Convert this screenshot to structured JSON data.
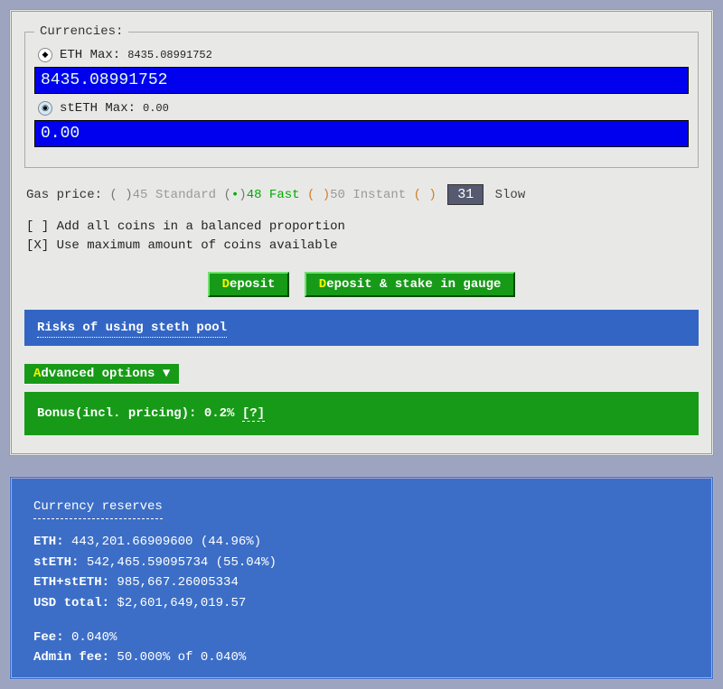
{
  "currencies": {
    "legend": "Currencies:",
    "eth": {
      "label": "ETH Max:",
      "max": "8435.08991752",
      "input": "8435.08991752"
    },
    "steth": {
      "label": "stETH Max:",
      "max": "0.00",
      "input": "0.00"
    }
  },
  "gas": {
    "label": "Gas price:",
    "standard": {
      "val": "45",
      "name": "Standard",
      "sel": false
    },
    "fast": {
      "val": "48",
      "name": "Fast",
      "sel": true
    },
    "instant": {
      "val": "50",
      "name": "Instant",
      "sel": false
    },
    "slow": {
      "val": "31",
      "name": "Slow"
    }
  },
  "opts": {
    "balanced_box": "[ ]",
    "balanced_label": "Add all coins in a balanced proportion",
    "usemax_box": "[X]",
    "usemax_label": "Use maximum amount of coins available"
  },
  "buttons": {
    "deposit_accent": "D",
    "deposit_rest": "eposit",
    "stake_accent": "D",
    "stake_rest": "eposit & stake in gauge"
  },
  "risks": "Risks of using steth pool",
  "advanced": {
    "toggle_accent": "A",
    "toggle_rest": "dvanced options ▼",
    "bonus_label": "Bonus(incl. pricing):",
    "bonus_val": "0.2%",
    "help": "[?]"
  },
  "reserves": {
    "title": "Currency reserves",
    "eth_label": "ETH:",
    "eth_val": "443,201.66909600 (44.96%)",
    "steth_label": "stETH:",
    "steth_val": "542,465.59095734 (55.04%)",
    "sum_label": "ETH+stETH:",
    "sum_val": "985,667.26005334",
    "usd_label": "USD total:",
    "usd_val": "$2,601,649,019.57",
    "fee_label": "Fee:",
    "fee_val": "0.040%",
    "admin_label": "Admin fee:",
    "admin_val": "50.000% of 0.040%"
  }
}
